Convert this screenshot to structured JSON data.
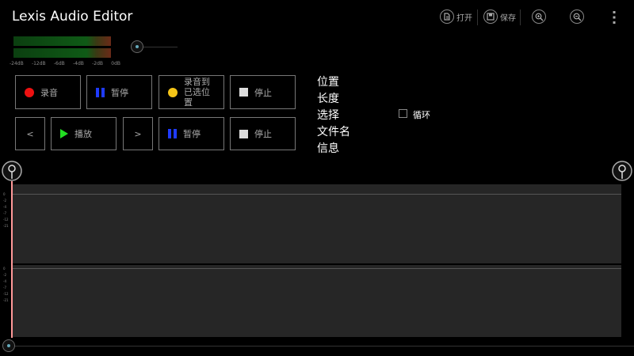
{
  "app": {
    "title": "Lexis Audio Editor"
  },
  "toolbar": {
    "open_label": "打开",
    "save_label": "保存",
    "zoom_in_icon": "zoom-in-icon",
    "zoom_out_icon": "zoom-out-icon",
    "more_icon": "more-vert-icon"
  },
  "meter": {
    "ticks": [
      "-24dB",
      "-12dB",
      "-6dB",
      "-4dB",
      "-2dB",
      "0dB"
    ],
    "colors": {
      "bar": "#0f5a16",
      "bar_hot": "#6b2a18"
    }
  },
  "record_row": {
    "record": "录音",
    "pause": "暂停",
    "record_at_selected": "录音到已选位置",
    "stop": "停止"
  },
  "play_row": {
    "prev": "<",
    "play": "播放",
    "next": ">",
    "pause": "暂停",
    "stop": "停止"
  },
  "info_panel": {
    "position_label": "位置",
    "length_label": "长度",
    "selection_label": "选择",
    "filename_label": "文件名",
    "info_label": "信息",
    "loop_label": "循环",
    "loop_checked": false
  },
  "waveform": {
    "db_labels": [
      "0",
      "-2",
      "-4",
      "-7",
      "-12",
      "-21"
    ],
    "colors": {
      "background": "#262626",
      "playhead": "#ff8888"
    }
  },
  "colors": {
    "record": "#ee1111",
    "record_selected": "#f5c518",
    "pause": "#1f3bff",
    "play": "#22dd22",
    "stop": "#dddddd"
  }
}
